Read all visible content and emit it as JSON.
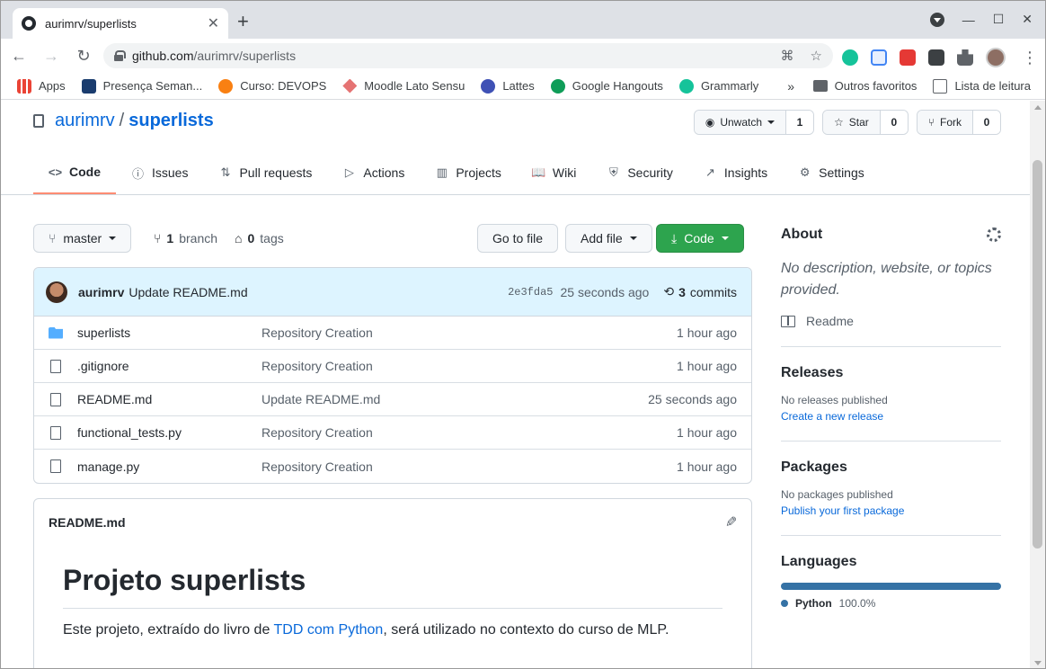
{
  "browser": {
    "tab_title": "aurimrv/superlists",
    "tab_close": "✕",
    "new_tab": "+",
    "url_host": "github.com",
    "url_path": "/aurimrv/superlists",
    "bookmarks": [
      "Apps",
      "Presença Seman...",
      "Curso: DEVOPS",
      "Moodle Lato Sensu",
      "Lattes",
      "Google Hangouts",
      "Grammarly"
    ],
    "bookmarks_more": "»",
    "bookmarks_right": [
      "Outros favoritos",
      "Lista de leitura"
    ]
  },
  "repo": {
    "owner": "aurimrv",
    "separator": "/",
    "name": "superlists",
    "watch_label": "Unwatch",
    "watch_count": "1",
    "star_label": "Star",
    "star_count": "0",
    "fork_label": "Fork",
    "fork_count": "0"
  },
  "nav": {
    "tabs": [
      "Code",
      "Issues",
      "Pull requests",
      "Actions",
      "Projects",
      "Wiki",
      "Security",
      "Insights",
      "Settings"
    ]
  },
  "branchbar": {
    "branch": "master",
    "branch_count": "1",
    "branch_word": "branch",
    "tag_count": "0",
    "tag_word": "tags",
    "go_to_file": "Go to file",
    "add_file": "Add file",
    "code": "Code"
  },
  "commit": {
    "author": "aurimrv",
    "message": "Update README.md",
    "sha": "2e3fda5",
    "time": "25 seconds ago",
    "commit_count": "3",
    "commit_word": "commits"
  },
  "files": [
    {
      "type": "dir",
      "name": "superlists",
      "message": "Repository Creation",
      "age": "1 hour ago"
    },
    {
      "type": "file",
      "name": ".gitignore",
      "message": "Repository Creation",
      "age": "1 hour ago"
    },
    {
      "type": "file",
      "name": "README.md",
      "message": "Update README.md",
      "age": "25 seconds ago"
    },
    {
      "type": "file",
      "name": "functional_tests.py",
      "message": "Repository Creation",
      "age": "1 hour ago"
    },
    {
      "type": "file",
      "name": "manage.py",
      "message": "Repository Creation",
      "age": "1 hour ago"
    }
  ],
  "readme": {
    "filename": "README.md",
    "heading": "Projeto superlists",
    "text_before": "Este projeto, extraído do livro de ",
    "link": "TDD com Python",
    "text_after": ", será utilizado no contexto do curso de MLP."
  },
  "sidebar": {
    "about_title": "About",
    "about_desc": "No description, website, or topics provided.",
    "readme_label": "Readme",
    "releases_title": "Releases",
    "releases_none": "No releases published",
    "releases_link": "Create a new release",
    "packages_title": "Packages",
    "packages_none": "No packages published",
    "packages_link": "Publish your first package",
    "languages_title": "Languages",
    "language_name": "Python",
    "language_pct": "100.0%",
    "language_color": "#3572a5"
  }
}
